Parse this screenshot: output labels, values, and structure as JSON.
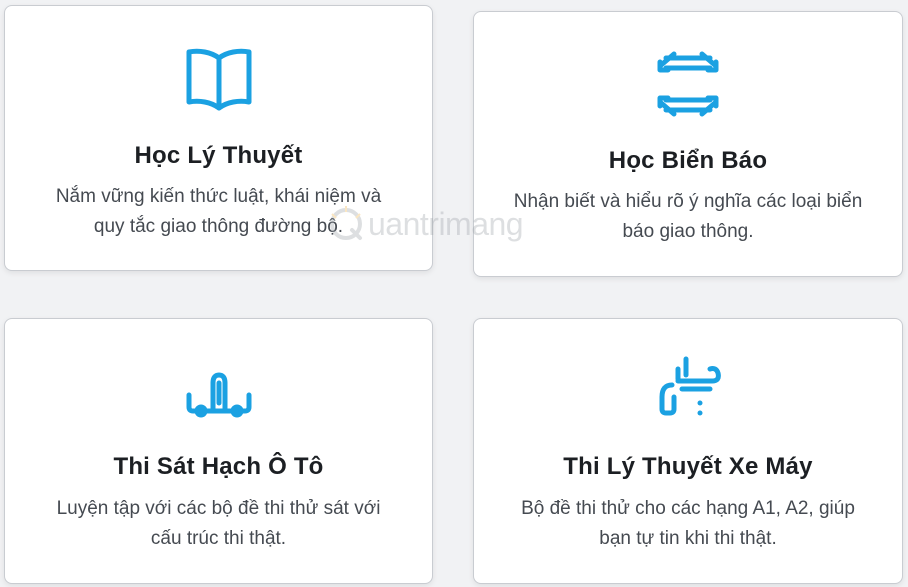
{
  "cards": [
    {
      "icon": "open-book-icon",
      "title": "Học Lý Thuyết",
      "desc_line1": "Nắm vững kiến thức luật, khái niệm và",
      "desc_line2": "quy tắc giao thông đường bộ."
    },
    {
      "icon": "road-sign-arrows-icon",
      "title": "Học Biển Báo",
      "desc_line1": "Nhận biết và hiểu rõ ý nghĩa các loại biển",
      "desc_line2": "báo giao thông."
    },
    {
      "icon": "car-test-icon",
      "title": "Thi Sát Hạch Ô Tô",
      "desc_line1": "Luyện tập với các bộ đề thi thử sát với",
      "desc_line2": "cấu trúc thi thật."
    },
    {
      "icon": "motorbike-test-icon",
      "title": "Thi Lý Thuyết Xe Máy",
      "desc_line1": "Bộ đề thi thử cho các hạng A1, A2, giúp",
      "desc_line2": "bạn tự tin khi thi thật."
    }
  ],
  "watermark": {
    "text": "uantrimang"
  },
  "colors": {
    "accent": "#1ba1e2",
    "card_bg": "#ffffff",
    "page_bg": "#f1f2f4",
    "title": "#1c1f23",
    "text": "#454a51"
  }
}
